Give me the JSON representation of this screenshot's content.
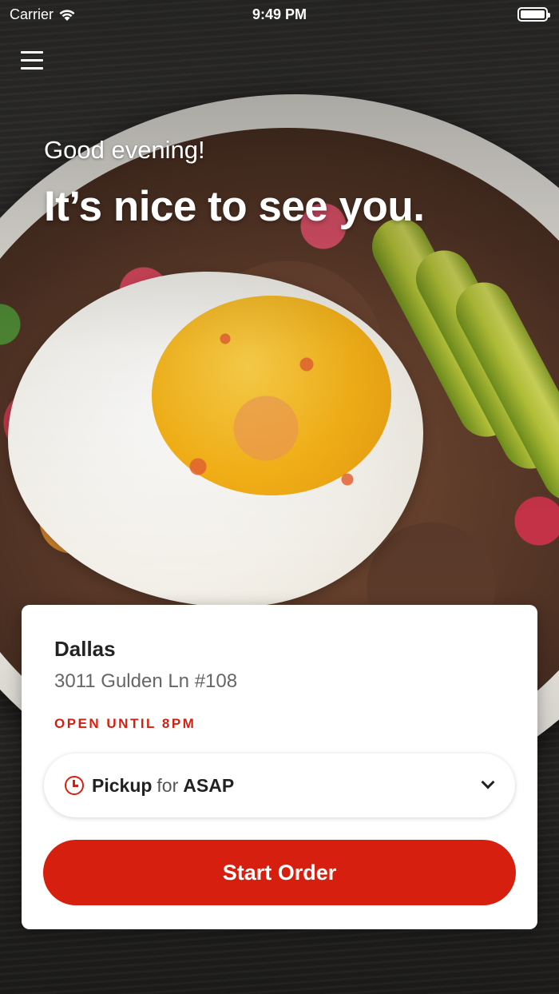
{
  "status_bar": {
    "carrier": "Carrier",
    "time": "9:49 PM"
  },
  "hero": {
    "greeting": "Good evening!",
    "headline": "It’s nice to see you."
  },
  "store": {
    "name": "Dallas",
    "address": "3011 Gulden Ln #108",
    "hours": "OPEN UNTIL 8PM"
  },
  "order_type": {
    "mode": "Pickup",
    "connector": "for",
    "time": "ASAP"
  },
  "actions": {
    "start_order": "Start Order"
  },
  "colors": {
    "accent": "#d71f0f"
  },
  "icons": [
    "menu-icon",
    "wifi-icon",
    "battery-icon",
    "clock-icon",
    "chevron-down-icon"
  ]
}
